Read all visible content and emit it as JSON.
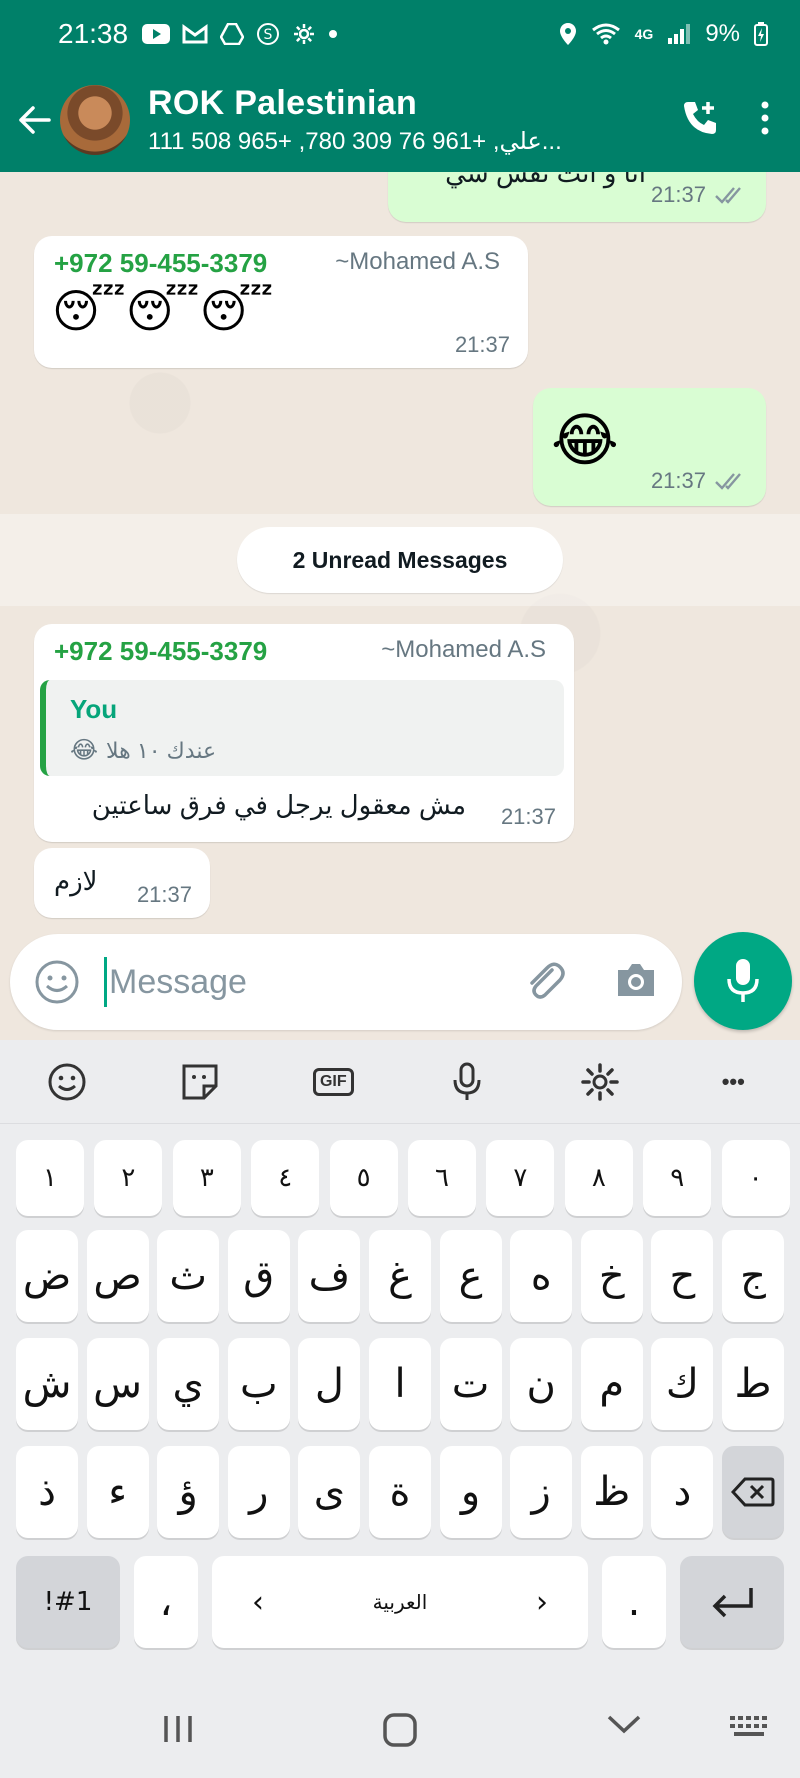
{
  "status_bar": {
    "time": "21:38",
    "battery": "9%",
    "network": "4G"
  },
  "header": {
    "title": "ROK Palestinian",
    "subtitle": "علي, +961 76 309 780, +965 508 111..."
  },
  "messages": [
    {
      "id": "m0",
      "dir": "out",
      "text": "انا و انت نفس شي",
      "time": "21:37",
      "ticks": "double"
    },
    {
      "id": "m1",
      "dir": "in",
      "sender": "+972 59-455-3379",
      "alias": "~Mohamed A.S",
      "text": "😴😴😴",
      "time": "21:37"
    },
    {
      "id": "m2",
      "dir": "out",
      "text": "😂",
      "time": "21:37",
      "ticks": "double"
    },
    {
      "id": "m3",
      "dir": "in",
      "sender": "+972 59-455-3379",
      "alias": "~Mohamed A.S",
      "quote_name": "You",
      "quote_text": "عندك ١٠ هلا",
      "quote_emoji": "😂",
      "text": "مش معقول يرجل في فرق ساعتين",
      "time": "21:37"
    },
    {
      "id": "m4",
      "dir": "in",
      "text": "لازم",
      "time": "21:37"
    }
  ],
  "unread_label": "2 Unread Messages",
  "composer": {
    "placeholder": "Message"
  },
  "keyboard": {
    "tools": [
      "emoji",
      "sticker",
      "GIF",
      "voice",
      "settings",
      "more"
    ],
    "gif_label": "GIF",
    "more_label": "•••",
    "row1": [
      "١",
      "٢",
      "٣",
      "٤",
      "٥",
      "٦",
      "٧",
      "٨",
      "٩",
      "٠"
    ],
    "row2": [
      "ض",
      "ص",
      "ث",
      "ق",
      "ف",
      "غ",
      "ع",
      "ه",
      "خ",
      "ح",
      "ج"
    ],
    "row3": [
      "ش",
      "س",
      "ي",
      "ب",
      "ل",
      "ا",
      "ت",
      "ن",
      "م",
      "ك",
      "ط"
    ],
    "row4": [
      "ذ",
      "ء",
      "ؤ",
      "ر",
      "ى",
      "ة",
      "و",
      "ز",
      "ظ",
      "د"
    ],
    "symbols_label": "!#1",
    "comma": "،",
    "space_label": "العربية",
    "left_arrow": "‹",
    "right_arrow": "›",
    "period": "."
  },
  "colors": {
    "brand": "#008069",
    "accent": "#00a884",
    "outgoing_bubble": "#d9fdd3",
    "sender_name": "#25a244"
  }
}
